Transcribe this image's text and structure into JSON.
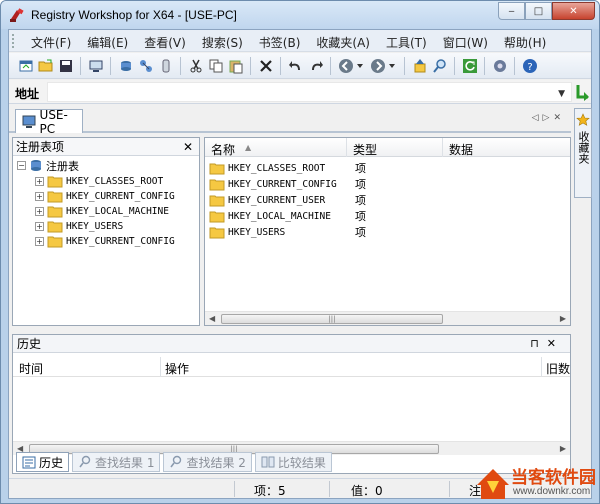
{
  "window": {
    "title": "Registry Workshop for X64 - [USE-PC]",
    "controls": {
      "minimize": "‒",
      "maximize": "□",
      "close": "✕"
    }
  },
  "menu": [
    "文件(F)",
    "编辑(E)",
    "查看(V)",
    "搜索(S)",
    "书签(B)",
    "收藏夹(A)",
    "工具(T)",
    "窗口(W)",
    "帮助(H)"
  ],
  "toolbar": {
    "icons": [
      "new-window-icon",
      "open-folder-icon",
      "save-icon",
      "remote-registry-icon",
      "registry-key-icon",
      "network-icon",
      "hive-icon",
      "cut-icon",
      "copy-icon",
      "paste-icon",
      "delete-icon",
      "undo-icon",
      "redo-icon",
      "back-icon",
      "dropdown-icon",
      "forward-icon",
      "dropdown-icon",
      "up-level-icon",
      "find-icon",
      "refresh-icon",
      "settings-icon",
      "help-icon"
    ]
  },
  "address": {
    "label": "地址",
    "value": ""
  },
  "doc_tab": {
    "label": "USE-PC"
  },
  "favorites_side": {
    "label": "收藏夹"
  },
  "left_panel": {
    "title": "注册表项",
    "close": "✕",
    "root": "注册表",
    "keys": [
      "HKEY_CLASSES_ROOT",
      "HKEY_CURRENT_CONFIG",
      "HKEY_LOCAL_MACHINE",
      "HKEY_USERS",
      "HKEY_CURRENT_CONFIG"
    ]
  },
  "right_panel": {
    "columns": [
      "名称",
      "类型",
      "数据"
    ],
    "rows": [
      {
        "name": "HKEY_CLASSES_ROOT",
        "type": "项"
      },
      {
        "name": "HKEY_CURRENT_CONFIG",
        "type": "项"
      },
      {
        "name": "HKEY_CURRENT_USER",
        "type": "项"
      },
      {
        "name": "HKEY_LOCAL_MACHINE",
        "type": "项"
      },
      {
        "name": "HKEY_USERS",
        "type": "项"
      }
    ]
  },
  "history": {
    "title": "历史",
    "pin": "⊓",
    "close": "✕",
    "columns": [
      "时间",
      "操作",
      "旧数据"
    ]
  },
  "bottom_tabs": [
    "历史",
    "查找结果 1",
    "查找结果 2",
    "比较结果"
  ],
  "status": {
    "items": "项：5",
    "values": "值：0",
    "extra": "注"
  },
  "watermark": {
    "brand": "当客软件园",
    "url": "www.downkr.com"
  },
  "colors": {
    "folder": "#f5c842",
    "accent": "#3a6ea5"
  }
}
